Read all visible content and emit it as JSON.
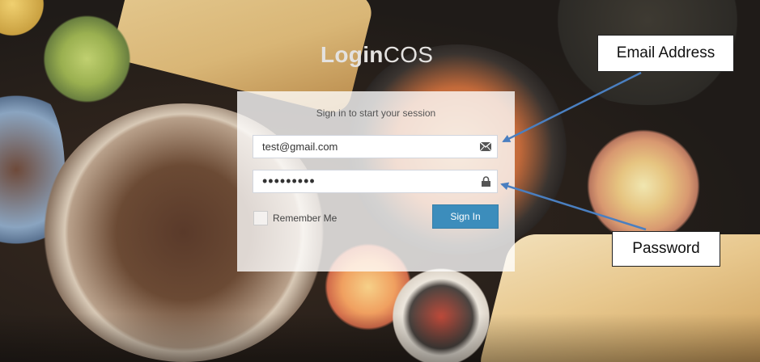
{
  "logo": {
    "bold": "Login",
    "light": "COS"
  },
  "login_box": {
    "message": "Sign in to start your session",
    "email": {
      "value": "test@gmail.com",
      "icon": "envelope-icon"
    },
    "password": {
      "value": "•••••••••",
      "icon": "lock-icon"
    },
    "remember_label": "Remember Me",
    "remember_checked": false,
    "signin_label": "Sign In"
  },
  "annotations": {
    "email_label": "Email Address",
    "password_label": "Password"
  },
  "colors": {
    "button": "#3c8dbc",
    "arrow": "#4a7fc0",
    "panel": "rgba(255,255,255,0.78)"
  }
}
